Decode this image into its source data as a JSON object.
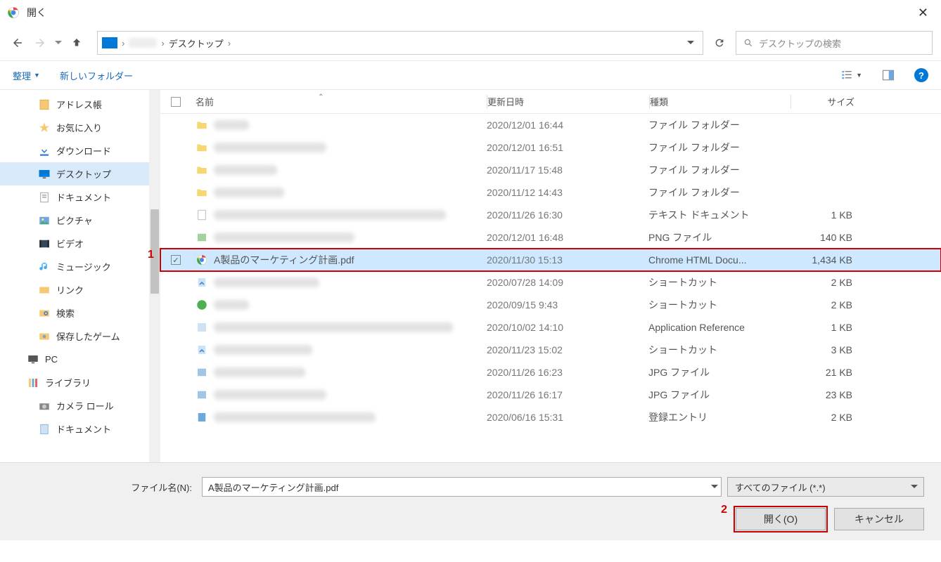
{
  "titlebar": {
    "title": "開く"
  },
  "breadcrumb": {
    "current": "デスクトップ"
  },
  "search": {
    "placeholder": "デスクトップの検索"
  },
  "toolbar": {
    "organize": "整理",
    "newfolder": "新しいフォルダー"
  },
  "columns": {
    "name": "名前",
    "date": "更新日時",
    "type": "種類",
    "size": "サイズ"
  },
  "sidebar": {
    "items": [
      {
        "label": "アドレス帳",
        "icon": "book"
      },
      {
        "label": "お気に入り",
        "icon": "star"
      },
      {
        "label": "ダウンロード",
        "icon": "download"
      },
      {
        "label": "デスクトップ",
        "icon": "desktop",
        "selected": true
      },
      {
        "label": "ドキュメント",
        "icon": "doc"
      },
      {
        "label": "ピクチャ",
        "icon": "pic"
      },
      {
        "label": "ビデオ",
        "icon": "video"
      },
      {
        "label": "ミュージック",
        "icon": "music"
      },
      {
        "label": "リンク",
        "icon": "link"
      },
      {
        "label": "検索",
        "icon": "search"
      },
      {
        "label": "保存したゲーム",
        "icon": "game"
      },
      {
        "label": "PC",
        "icon": "pc",
        "root": true
      },
      {
        "label": "ライブラリ",
        "icon": "lib",
        "root": true
      },
      {
        "label": "カメラ ロール",
        "icon": "cam"
      },
      {
        "label": "ドキュメント",
        "icon": "doc2"
      }
    ]
  },
  "files": [
    {
      "blurw": 50,
      "date": "2020/12/01 16:44",
      "type": "ファイル フォルダー",
      "size": "",
      "icon": "folder"
    },
    {
      "blurw": 160,
      "date": "2020/12/01 16:51",
      "type": "ファイル フォルダー",
      "size": "",
      "icon": "folder"
    },
    {
      "blurw": 90,
      "date": "2020/11/17 15:48",
      "type": "ファイル フォルダー",
      "size": "",
      "icon": "folder"
    },
    {
      "blurw": 100,
      "date": "2020/11/12 14:43",
      "type": "ファイル フォルダー",
      "size": "",
      "icon": "folder"
    },
    {
      "blurw": 330,
      "date": "2020/11/26 16:30",
      "type": "テキスト ドキュメント",
      "size": "1 KB",
      "icon": "txt"
    },
    {
      "blurw": 200,
      "date": "2020/12/01 16:48",
      "type": "PNG ファイル",
      "size": "140 KB",
      "icon": "png"
    },
    {
      "name": "A製品のマーケティング計画.pdf",
      "date": "2020/11/30 15:13",
      "type": "Chrome HTML Docu...",
      "size": "1,434 KB",
      "icon": "chrome",
      "selected": true
    },
    {
      "blurw": 150,
      "date": "2020/07/28 14:09",
      "type": "ショートカット",
      "size": "2 KB",
      "icon": "lnk"
    },
    {
      "blurw": 50,
      "date": "2020/09/15 9:43",
      "type": "ショートカット",
      "size": "2 KB",
      "icon": "green"
    },
    {
      "blurw": 340,
      "date": "2020/10/02 14:10",
      "type": "Application Reference",
      "size": "1 KB",
      "icon": "app"
    },
    {
      "blurw": 140,
      "date": "2020/11/23 15:02",
      "type": "ショートカット",
      "size": "3 KB",
      "icon": "lnk"
    },
    {
      "blurw": 130,
      "date": "2020/11/26 16:23",
      "type": "JPG ファイル",
      "size": "21 KB",
      "icon": "jpg"
    },
    {
      "blurw": 160,
      "date": "2020/11/26 16:17",
      "type": "JPG ファイル",
      "size": "23 KB",
      "icon": "jpg"
    },
    {
      "blurw": 230,
      "date": "2020/06/16 15:31",
      "type": "登録エントリ",
      "size": "2 KB",
      "icon": "reg"
    }
  ],
  "bottom": {
    "file_label": "ファイル名(N):",
    "file_value": "A製品のマーケティング計画.pdf",
    "filter": "すべてのファイル (*.*)",
    "open": "開く(O)",
    "cancel": "キャンセル"
  },
  "annotations": {
    "one": "1",
    "two": "2"
  }
}
